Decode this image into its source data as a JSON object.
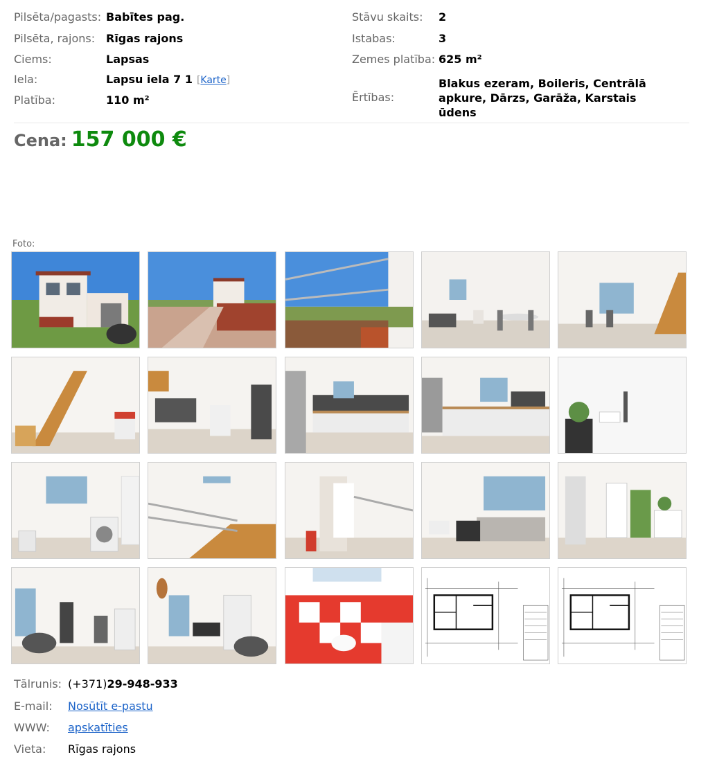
{
  "details": {
    "left": [
      {
        "label": "Pilsēta/pagasts:",
        "value": "Babītes pag."
      },
      {
        "label": "Pilsēta, rajons:",
        "value": "Rīgas rajons"
      },
      {
        "label": "Ciems:",
        "value": "Lapsas"
      },
      {
        "label": "Iela:",
        "value": "Lapsu iela 7 1",
        "map_link": "Karte"
      },
      {
        "label": "Platība:",
        "value": "110 m²"
      }
    ],
    "right": [
      {
        "label": "Stāvu skaits:",
        "value": "2"
      },
      {
        "label": "Istabas:",
        "value": "3"
      },
      {
        "label": "Zemes platība:",
        "value": "625 m²"
      }
    ],
    "amenities_label": "Ērtības:",
    "amenities_value": "Blakus ezeram, Boileris, Centrālā apkure, Dārzs, Garāža, Karstais ūdens"
  },
  "price": {
    "label": "Cena:",
    "value": "157 000 €",
    "color": "#0e8a0e"
  },
  "photos_label": "Foto:",
  "photos": [
    {
      "type": "exterior-house"
    },
    {
      "type": "exterior-street"
    },
    {
      "type": "balcony"
    },
    {
      "type": "living-dining"
    },
    {
      "type": "dining-stairs"
    },
    {
      "type": "stairs-hall"
    },
    {
      "type": "kitchen-hall"
    },
    {
      "type": "kitchen"
    },
    {
      "type": "kitchen2"
    },
    {
      "type": "bathroom-small"
    },
    {
      "type": "laundry"
    },
    {
      "type": "stair-railing"
    },
    {
      "type": "corridor"
    },
    {
      "type": "bedroom"
    },
    {
      "type": "room-window"
    },
    {
      "type": "living-chair"
    },
    {
      "type": "office"
    },
    {
      "type": "bathroom-red"
    },
    {
      "type": "floorplan"
    },
    {
      "type": "floorplan"
    }
  ],
  "contact": {
    "phone_label": "Tālrunis:",
    "phone_prefix": "(+371)",
    "phone_number": "29-948-933",
    "email_label": "E-mail:",
    "email_link": "Nosūtīt e-pastu",
    "www_label": "WWW:",
    "www_link": "apskatīties",
    "place_label": "Vieta:",
    "place_value": "Rīgas rajons"
  },
  "colors": {
    "link": "#1a62c8",
    "label": "#666666"
  }
}
